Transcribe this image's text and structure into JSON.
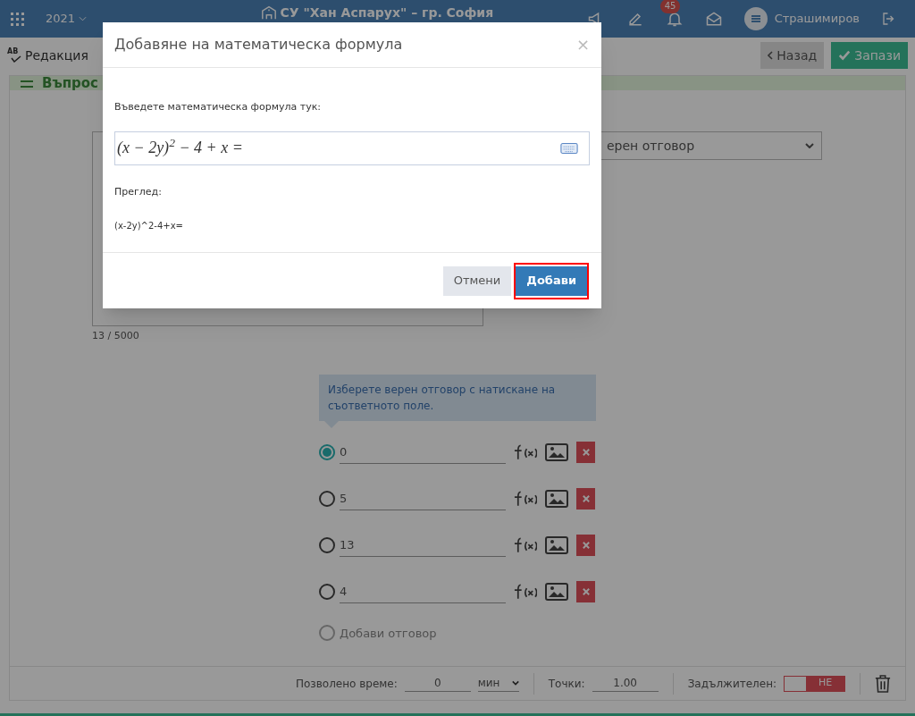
{
  "navbar": {
    "year": "2021",
    "school": "СУ \"Хан Аспарух\" – гр. София",
    "notifications": "45",
    "user": "Страшимиров"
  },
  "subheader": {
    "icon_text": "AB",
    "title": "Редакция",
    "back": "Назад",
    "save": "Запази"
  },
  "section": {
    "title": "Въпрос"
  },
  "question": {
    "counter": "13 / 5000",
    "select": "ерен отговор"
  },
  "hint": "Изберете верен отговор с натискане на съответното поле.",
  "answers": [
    {
      "value": "0",
      "selected": true
    },
    {
      "value": "5",
      "selected": false
    },
    {
      "value": "13",
      "selected": false
    },
    {
      "value": "4",
      "selected": false
    }
  ],
  "add_answer": {
    "label": "Добави отговор",
    "disabled": true
  },
  "footer": {
    "time_label": "Позволено време:",
    "time_value": "0",
    "unit": "мин",
    "points_label": "Точки:",
    "points_value": "1.00",
    "required_label": "Задължителен:",
    "required": {
      "on": false,
      "text": "НЕ"
    }
  },
  "dialog": {
    "title": "Добавяне на математическа формула",
    "close": "×",
    "prompt": "Въведете математическа формула тук:",
    "formula": "(x − 2y)$^{2}$ − 4 + x =",
    "preview_label": "Преглед:",
    "preview": "(x-2y)^2-4+x=",
    "buttons": [
      {
        "label": "Отмени",
        "kind": "secondary",
        "highlighted": false
      },
      {
        "label": "Добави",
        "kind": "primary",
        "highlighted": true
      }
    ]
  }
}
